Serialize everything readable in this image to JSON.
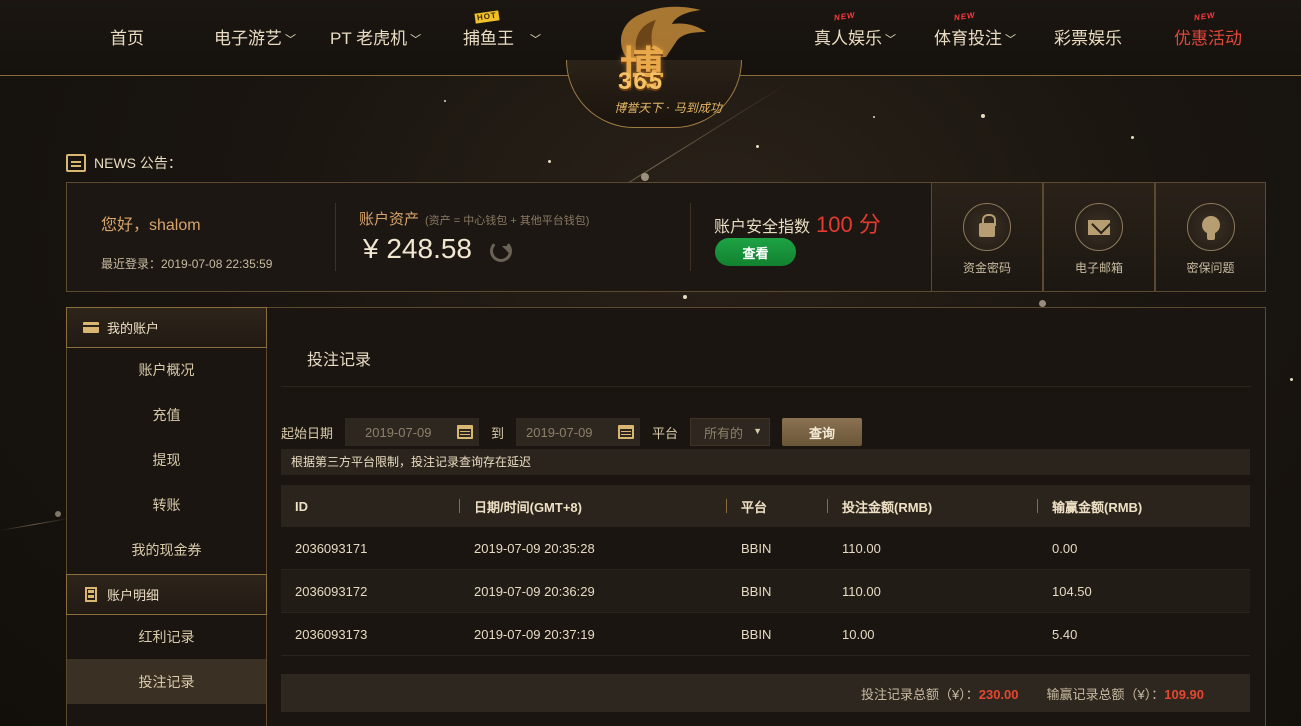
{
  "nav": {
    "items": [
      {
        "label": "首页"
      },
      {
        "label": "电子游艺"
      },
      {
        "label": "PT 老虎机"
      },
      {
        "label": "捕鱼王",
        "badge": "HOT"
      },
      {
        "label": "真人娱乐",
        "badge": "NEW"
      },
      {
        "label": "体育投注",
        "badge": "NEW"
      },
      {
        "label": "彩票娱乐"
      },
      {
        "label": "优惠活动",
        "badge": "NEW"
      }
    ]
  },
  "logo": {
    "main": "博",
    "num": "365",
    "slogan": "博誉天下 · 马到成功"
  },
  "news": {
    "label": "NEWS 公告："
  },
  "account": {
    "greeting": "您好，shalom",
    "last_login": "最近登录：2019-07-08 22:35:59",
    "asset_label": "账户资产",
    "asset_note": "(资产 = 中心钱包 + 其他平台钱包)",
    "asset_value": "¥ 248.58",
    "security_label": "账户安全指数",
    "security_score": "100 分",
    "check_button": "查看",
    "security_items": [
      {
        "label": "资金密码",
        "icon": "lock-icon"
      },
      {
        "label": "电子邮箱",
        "icon": "mail-icon"
      },
      {
        "label": "密保问题",
        "icon": "bulb-icon"
      }
    ]
  },
  "sidebar": {
    "group1": {
      "title": "我的账户",
      "items": [
        "账户概况",
        "充值",
        "提现",
        "转账",
        "我的现金券"
      ]
    },
    "group2": {
      "title": "账户明细",
      "items": [
        "红利记录",
        "投注记录"
      ]
    },
    "active": "投注记录"
  },
  "main": {
    "title": "投注记录",
    "filter": {
      "start_label": "起始日期",
      "start_value": "2019-07-09",
      "to_label": "到",
      "end_value": "2019-07-09",
      "platform_label": "平台",
      "platform_value": "所有的",
      "query_button": "查询"
    },
    "notice": "根据第三方平台限制，投注记录查询存在延迟",
    "table": {
      "headers": [
        "ID",
        "日期/时间(GMT+8)",
        "平台",
        "投注金额(RMB)",
        "输赢金额(RMB)"
      ],
      "rows": [
        [
          "2036093171",
          "2019-07-09 20:35:28",
          "BBIN",
          "110.00",
          "0.00"
        ],
        [
          "2036093172",
          "2019-07-09 20:36:29",
          "BBIN",
          "110.00",
          "104.50"
        ],
        [
          "2036093173",
          "2019-07-09 20:37:19",
          "BBIN",
          "10.00",
          "5.40"
        ]
      ]
    },
    "totals": {
      "bet_label": "投注记录总额（¥）：",
      "bet_value": "230.00",
      "win_label": "输赢记录总额（¥）：",
      "win_value": "109.90"
    }
  },
  "colors": {
    "accent": "#d9b773",
    "danger": "#e53a2e",
    "success": "#1ea345"
  }
}
